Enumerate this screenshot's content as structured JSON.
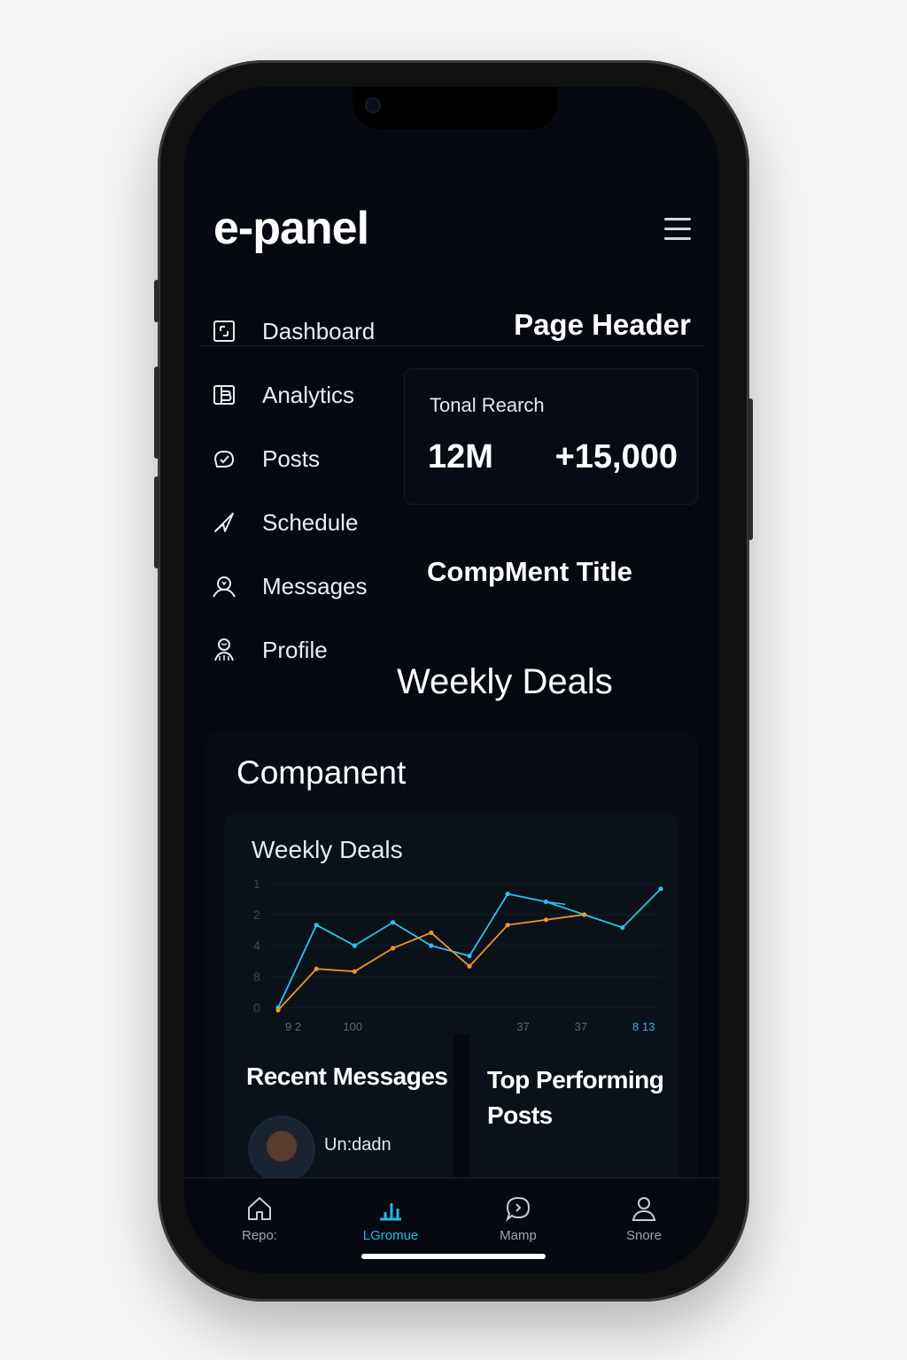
{
  "app": {
    "brand": "e-panel"
  },
  "nav": {
    "items": [
      {
        "label": "Dashboard",
        "icon": "dashboard-icon"
      },
      {
        "label": "Analytics",
        "icon": "analytics-icon"
      },
      {
        "label": "Posts",
        "icon": "posts-icon"
      },
      {
        "label": "Schedule",
        "icon": "send-icon"
      },
      {
        "label": "Messages",
        "icon": "messages-icon"
      },
      {
        "label": "Profile",
        "icon": "profile-icon"
      }
    ]
  },
  "main": {
    "page_header": "Page Header",
    "reach_card": {
      "label": "Tonal Rearch",
      "value_1": "12M",
      "value_2": "+15,000"
    },
    "component_title": "CompMent Title",
    "weekly_deals_title": "Weekly Deals"
  },
  "component": {
    "title": "Companent",
    "chart_title": "Weekly Deals",
    "recent_messages_title": "Recent Messages",
    "top_posts_title": "Top Performing Posts",
    "message_author": "Un:dadn"
  },
  "chart_data": {
    "type": "line",
    "title": "Weekly Deals",
    "y_tick_labels": [
      "1",
      "2",
      "4",
      "8",
      "0"
    ],
    "x_tick_labels": [
      "9 2",
      "100",
      "",
      "",
      "37",
      "37",
      "8 13"
    ],
    "series": [
      {
        "color": "#29c4ec",
        "points": [
          [
            0,
            0
          ],
          [
            1,
            3.2
          ],
          [
            2,
            2.4
          ],
          [
            3,
            3.3
          ],
          [
            4,
            2.4
          ],
          [
            5,
            2.0
          ],
          [
            6,
            4.4
          ],
          [
            7,
            4.1
          ],
          [
            8,
            3.6
          ],
          [
            9,
            3.1
          ],
          [
            10,
            4.6
          ]
        ],
        "trail": [
          [
            7,
            4.1
          ],
          [
            7.5,
            4.0
          ]
        ]
      },
      {
        "color": "#f2952c",
        "points": [
          [
            0,
            -0.1
          ],
          [
            1,
            1.5
          ],
          [
            2,
            1.4
          ],
          [
            3,
            2.3
          ],
          [
            4,
            2.9
          ],
          [
            5,
            1.6
          ],
          [
            6,
            3.2
          ],
          [
            7,
            3.4
          ],
          [
            8,
            3.6
          ]
        ]
      }
    ],
    "grid": true,
    "accent_colors": {
      "cyan": "#29c4ec",
      "orange": "#f2952c"
    }
  },
  "tabbar": {
    "tabs": [
      {
        "label": "Repo:",
        "icon": "home-icon",
        "active": false
      },
      {
        "label": "LGromue",
        "icon": "bar-chart-icon",
        "active": true
      },
      {
        "label": "Mamp",
        "icon": "chat-icon",
        "active": false
      },
      {
        "label": "Snore",
        "icon": "user-icon",
        "active": false
      }
    ]
  }
}
